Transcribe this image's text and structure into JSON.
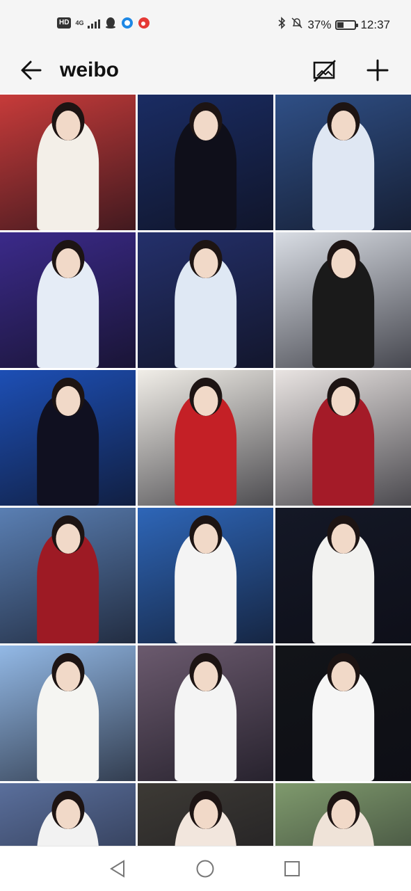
{
  "status_bar": {
    "hd": "HD",
    "network": "4G",
    "battery": "37%",
    "time": "12:37",
    "battery_level": 0.37
  },
  "app_bar": {
    "title": "weibo"
  },
  "grid": {
    "columns": 3,
    "rows": 6,
    "tiles": [
      {
        "name": "photo-1",
        "bg": "#c73b3a",
        "outfit": "#f3efe8"
      },
      {
        "name": "photo-2",
        "bg": "#1a2c63",
        "outfit": "#0f0f1a"
      },
      {
        "name": "photo-3",
        "bg": "#2f4f86",
        "outfit": "#dfe7f3"
      },
      {
        "name": "photo-4",
        "bg": "#3b2a8a",
        "outfit": "#e5ecf6"
      },
      {
        "name": "photo-5",
        "bg": "#24306b",
        "outfit": "#dfe8f4"
      },
      {
        "name": "photo-6",
        "bg": "#d9dde4",
        "outfit": "#1a1a1a"
      },
      {
        "name": "photo-7",
        "bg": "#1d4fb5",
        "outfit": "#101020"
      },
      {
        "name": "photo-8",
        "bg": "#f1eee8",
        "outfit": "#c42026"
      },
      {
        "name": "photo-9",
        "bg": "#e9e4e2",
        "outfit": "#a41b28"
      },
      {
        "name": "photo-10",
        "bg": "#5a7fb3",
        "outfit": "#9d1a24"
      },
      {
        "name": "photo-11",
        "bg": "#2e66b8",
        "outfit": "#f4f4f4"
      },
      {
        "name": "photo-12",
        "bg": "#141826",
        "outfit": "#f2f2f0"
      },
      {
        "name": "photo-13",
        "bg": "#93b9e6",
        "outfit": "#f5f5f2"
      },
      {
        "name": "photo-14",
        "bg": "#6b5a6e",
        "outfit": "#f4f4f4"
      },
      {
        "name": "photo-15",
        "bg": "#121418",
        "outfit": "#f6f6f6"
      },
      {
        "name": "photo-16",
        "bg": "#5a6f9c",
        "outfit": "#f2f2f2"
      },
      {
        "name": "photo-17",
        "bg": "#3d3a35",
        "outfit": "#f2e6dd"
      },
      {
        "name": "photo-18",
        "bg": "#7f9a6d",
        "outfit": "#efe3d8"
      }
    ]
  },
  "nav_bar": {
    "back_label": "",
    "home_label": "",
    "recents_label": ""
  }
}
